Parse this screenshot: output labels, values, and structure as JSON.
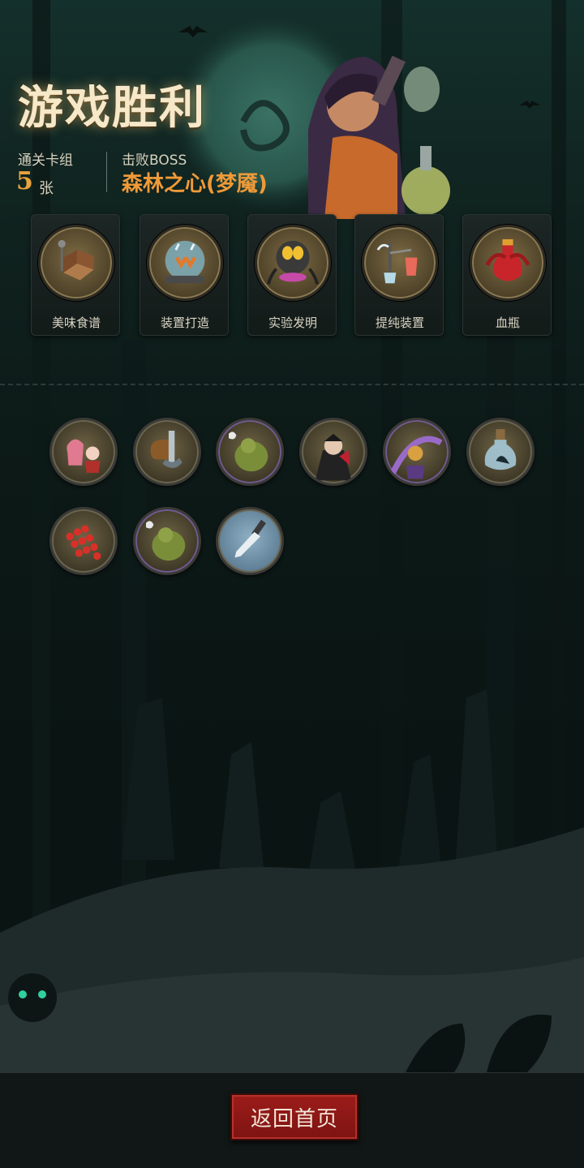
{
  "header": {
    "title": "游戏胜利",
    "deck_label": "通关卡组",
    "deck_count": "5",
    "deck_unit": "张",
    "boss_label": "击败BOSS",
    "boss_name": "森林之心(梦魇)"
  },
  "relics": [
    {
      "label": "美味食谱",
      "icon": "recipe-book-icon"
    },
    {
      "label": "装置打造",
      "icon": "device-forge-icon"
    },
    {
      "label": "实验发明",
      "icon": "experiment-invention-icon"
    },
    {
      "label": "提纯装置",
      "icon": "purification-apparatus-icon"
    },
    {
      "label": "血瓶",
      "icon": "blood-potion-icon"
    }
  ],
  "collected_cards": [
    {
      "icon": "twin-girls-card-icon",
      "frame": "gold"
    },
    {
      "icon": "pipe-wrench-card-icon",
      "frame": "gold"
    },
    {
      "icon": "green-ogre-card-icon",
      "frame": "purple"
    },
    {
      "icon": "vampire-card-icon",
      "frame": "gold"
    },
    {
      "icon": "purple-mage-card-icon",
      "frame": "purple"
    },
    {
      "icon": "bird-bottle-card-icon",
      "frame": "gold"
    },
    {
      "icon": "red-beads-card-icon",
      "frame": "gold"
    },
    {
      "icon": "green-ogre-card-icon",
      "frame": "purple"
    },
    {
      "icon": "dagger-card-icon",
      "frame": "blue"
    }
  ],
  "footer": {
    "home_button_label": "返回首页"
  },
  "colors": {
    "title_glow": "#f6e8c8",
    "accent_orange": "#ef9a38",
    "button_red": "#9c1c1a"
  }
}
